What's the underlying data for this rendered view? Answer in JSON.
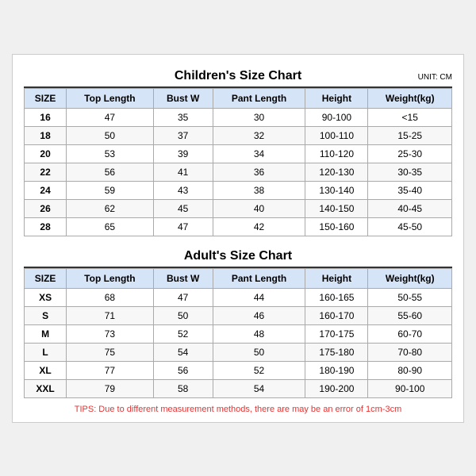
{
  "children_chart": {
    "title": "Children's Size Chart",
    "unit": "UNIT: CM",
    "columns": [
      "SIZE",
      "Top Length",
      "Bust W",
      "Pant Length",
      "Height",
      "Weight(kg)"
    ],
    "rows": [
      [
        "16",
        "47",
        "35",
        "30",
        "90-100",
        "<15"
      ],
      [
        "18",
        "50",
        "37",
        "32",
        "100-110",
        "15-25"
      ],
      [
        "20",
        "53",
        "39",
        "34",
        "110-120",
        "25-30"
      ],
      [
        "22",
        "56",
        "41",
        "36",
        "120-130",
        "30-35"
      ],
      [
        "24",
        "59",
        "43",
        "38",
        "130-140",
        "35-40"
      ],
      [
        "26",
        "62",
        "45",
        "40",
        "140-150",
        "40-45"
      ],
      [
        "28",
        "65",
        "47",
        "42",
        "150-160",
        "45-50"
      ]
    ]
  },
  "adult_chart": {
    "title": "Adult's Size Chart",
    "columns": [
      "SIZE",
      "Top Length",
      "Bust W",
      "Pant Length",
      "Height",
      "Weight(kg)"
    ],
    "rows": [
      [
        "XS",
        "68",
        "47",
        "44",
        "160-165",
        "50-55"
      ],
      [
        "S",
        "71",
        "50",
        "46",
        "160-170",
        "55-60"
      ],
      [
        "M",
        "73",
        "52",
        "48",
        "170-175",
        "60-70"
      ],
      [
        "L",
        "75",
        "54",
        "50",
        "175-180",
        "70-80"
      ],
      [
        "XL",
        "77",
        "56",
        "52",
        "180-190",
        "80-90"
      ],
      [
        "XXL",
        "79",
        "58",
        "54",
        "190-200",
        "90-100"
      ]
    ]
  },
  "tips": "TIPS: Due to different measurement methods, there are may be an error of 1cm-3cm"
}
